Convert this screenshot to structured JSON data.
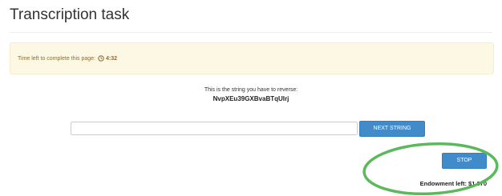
{
  "page": {
    "title": "Transcription task"
  },
  "timer": {
    "prefix": "Time left to complete this page:",
    "value": "4:32"
  },
  "task": {
    "instruction": "This is the string you have to reverse:",
    "string": "NvpXEu39GXBvaBTqUlrj"
  },
  "answer": {
    "value": "",
    "placeholder": ""
  },
  "buttons": {
    "next_label": "NEXT STRING",
    "stop_label": "STOP"
  },
  "endowment": {
    "text": "Endowment left: $1.370"
  },
  "colors": {
    "button": "#428bca",
    "alert_bg": "#fcf8e3",
    "alert_text": "#8a6d3b",
    "highlight": "#5cb85c"
  },
  "icons": {
    "timer": "clock-icon"
  }
}
